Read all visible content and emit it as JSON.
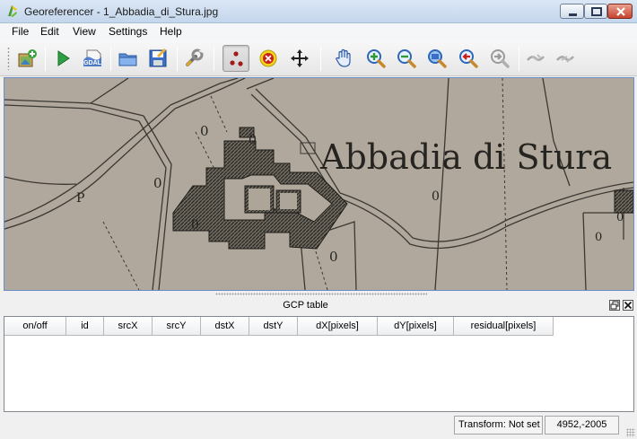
{
  "window": {
    "title": "Georeferencer - 1_Abbadia_di_Stura.jpg",
    "app_icon": "qgis-logo-icon",
    "controls": [
      "minimize-icon",
      "maximize-icon",
      "close-icon"
    ]
  },
  "menubar": {
    "items": [
      {
        "label": "File"
      },
      {
        "label": "Edit"
      },
      {
        "label": "View"
      },
      {
        "label": "Settings"
      },
      {
        "label": "Help"
      }
    ]
  },
  "toolbar": {
    "buttons": [
      {
        "icon": "open-raster-icon"
      },
      {
        "icon": "start-georeferencing-icon"
      },
      {
        "icon": "generate-gdal-script-icon",
        "text": "GDAL"
      },
      {
        "icon": "load-gcp-points-icon"
      },
      {
        "icon": "save-gcp-points-icon"
      },
      {
        "icon": "transformation-settings-icon"
      },
      {
        "icon": "add-point-icon",
        "active": true
      },
      {
        "icon": "delete-point-icon"
      },
      {
        "icon": "move-gcp-point-icon"
      },
      {
        "icon": "pan-icon"
      },
      {
        "icon": "zoom-in-icon"
      },
      {
        "icon": "zoom-out-icon"
      },
      {
        "icon": "zoom-to-layer-icon"
      },
      {
        "icon": "zoom-last-icon"
      },
      {
        "icon": "zoom-next-icon"
      },
      {
        "icon": "link-georeferencer-to-qgis-icon"
      },
      {
        "icon": "link-qgis-to-georeferencer-icon"
      }
    ]
  },
  "map": {
    "place_name": "Abbadia di Stura",
    "markers": [
      "0",
      "0",
      "0",
      "P",
      "0",
      "0",
      "0",
      "0",
      "0"
    ],
    "colors": {
      "paper": "#aca598",
      "ink": "#262420"
    }
  },
  "gcp_panel": {
    "title": "GCP table",
    "float_icon": "float-dock-icon",
    "close_icon": "close-dock-icon",
    "columns": [
      "on/off",
      "id",
      "srcX",
      "srcY",
      "dstX",
      "dstY",
      "dX[pixels]",
      "dY[pixels]",
      "residual[pixels]"
    ],
    "rows": []
  },
  "statusbar": {
    "transform": "Transform: Not set",
    "coordinates": "4952,-2005"
  }
}
